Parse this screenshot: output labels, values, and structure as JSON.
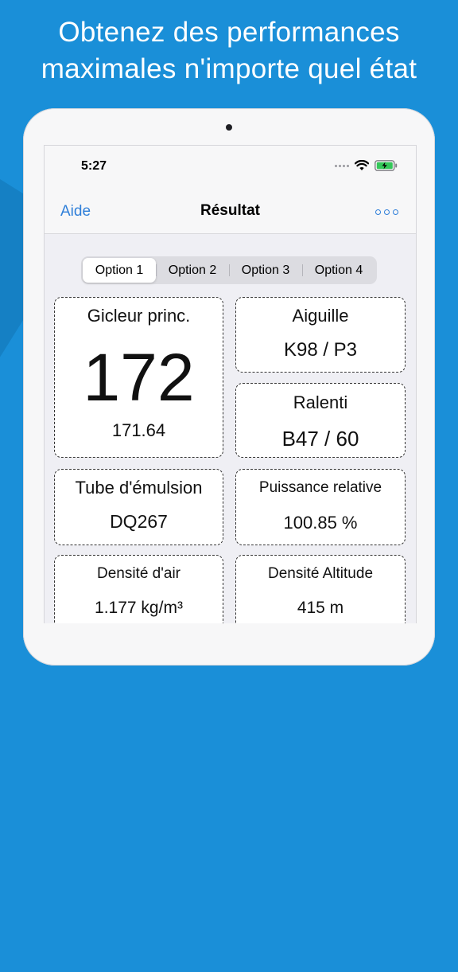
{
  "headline": {
    "line1": "Obtenez des performances",
    "line2": "maximales n'importe quel état"
  },
  "status_bar": {
    "time": "5:27",
    "icons": [
      "cellular-dots-icon",
      "wifi-icon",
      "battery-charging-icon"
    ],
    "battery_color": "#34c759"
  },
  "nav": {
    "left_label": "Aide",
    "title": "Résultat",
    "more_icon": "ellipsis-icon",
    "accent": "#2f7fd9"
  },
  "segmented": {
    "options": [
      "Option 1",
      "Option 2",
      "Option 3",
      "Option 4"
    ],
    "selected": "Option 1"
  },
  "cards": {
    "main_jet": {
      "label": "Gicleur princ.",
      "value": "172",
      "sub": "171.64"
    },
    "needle": {
      "label": "Aiguille",
      "value": "K98 / P3"
    },
    "idle": {
      "label": "Ralenti",
      "value": "B47 / 60"
    },
    "emulsion_tube": {
      "label": "Tube d'émulsion",
      "value": "DQ267"
    },
    "relative_power": {
      "label": "Puissance relative",
      "value": "100.85 %"
    },
    "air_density": {
      "label": "Densité d'air",
      "value": "1.177 kg/m³"
    },
    "density_altitude": {
      "label": "Densité Altitude",
      "value": "415 m"
    }
  }
}
